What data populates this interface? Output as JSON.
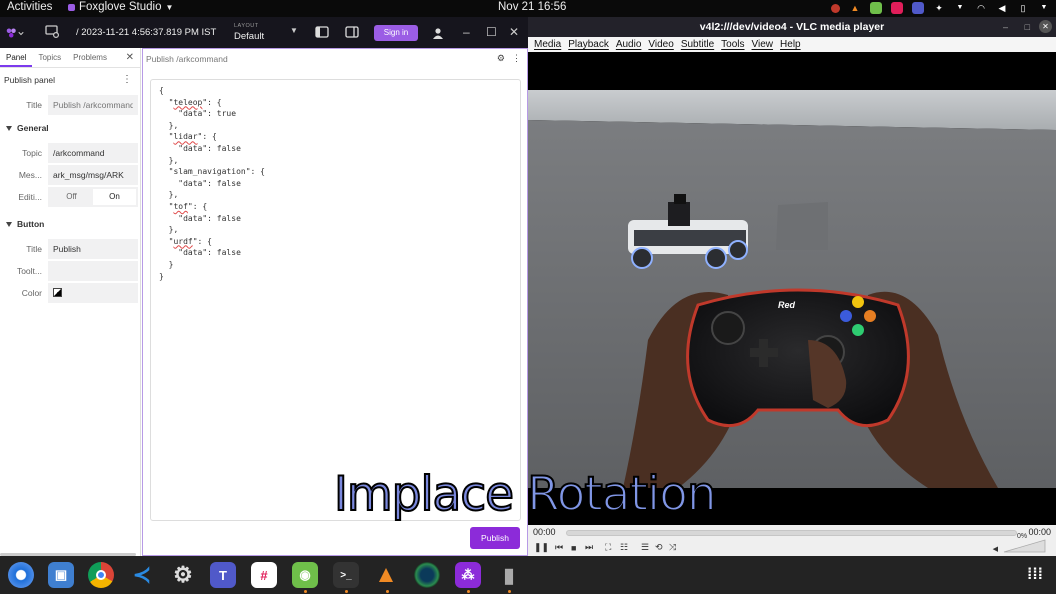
{
  "topbar": {
    "activities": "Activities",
    "app_name": "Foxglove Studio",
    "clock": "Nov 21  16:56"
  },
  "foxglove": {
    "timestamp": "/ 2023-11-21 4:56:37.819 PM IST",
    "layout_label": "LAYOUT",
    "layout_value": "Default",
    "signin_label": "Sign in",
    "sidebar": {
      "tabs": [
        "Panel",
        "Topics",
        "Problems"
      ],
      "header": "Publish panel",
      "title_label": "Title",
      "title_placeholder": "Publish /arkcommand",
      "general_label": "General",
      "topic_label": "Topic",
      "topic_value": "/arkcommand",
      "message_label": "Mes...",
      "message_value": "ark_msg/msg/ARK",
      "editing_label": "Editi...",
      "editing_off": "Off",
      "editing_on": "On",
      "button_label": "Button",
      "btn_title_label": "Title",
      "btn_title_value": "Publish",
      "tooltip_label": "Toolt...",
      "tooltip_value": "",
      "color_label": "Color"
    },
    "panel": {
      "title": "Publish /arkcommand",
      "editor_lines": [
        "{",
        "  \"teleop\": {",
        "    \"data\": true",
        "  },",
        "  \"lidar\": {",
        "    \"data\": false",
        "  },",
        "  \"slam_navigation\": {",
        "    \"data\": false",
        "  },",
        "  \"tof\": {",
        "    \"data\": false",
        "  },",
        "  \"urdf\": {",
        "    \"data\": false",
        "  }",
        "}"
      ],
      "publish_label": "Publish"
    }
  },
  "vlc": {
    "title": "v4l2:///dev/video4 - VLC media player",
    "menu": [
      "Media",
      "Playback",
      "Audio",
      "Video",
      "Subtitle",
      "Tools",
      "View",
      "Help"
    ],
    "time_elapsed": "00:00",
    "time_total": "00:00",
    "volume": "0%"
  },
  "caption": {
    "word1": "Implace",
    "word2": "Rotation"
  },
  "colors": {
    "accent": "#9b5de5",
    "publish_button": "#8c2bd9",
    "dock_indicator": "#f08a24"
  }
}
